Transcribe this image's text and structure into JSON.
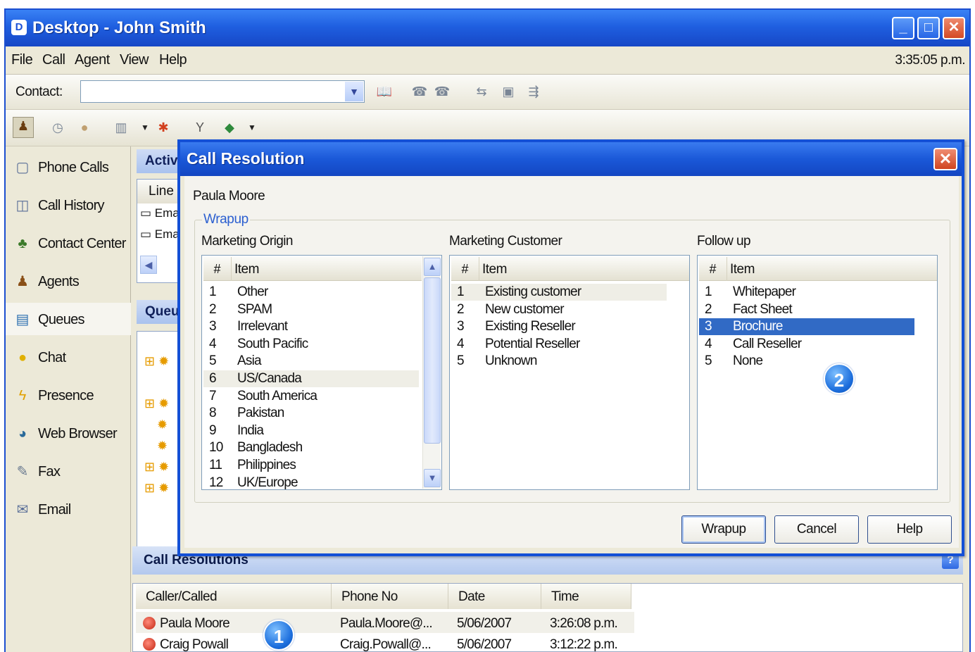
{
  "window": {
    "title": "Desktop - John Smith",
    "clock": "3:35:05 p.m."
  },
  "menu": [
    "File",
    "Call",
    "Agent",
    "View",
    "Help"
  ],
  "toolbar": {
    "contact_label": "Contact:",
    "contact_value": ""
  },
  "nav": [
    {
      "label": "Phone Calls",
      "icon": "phone-icon"
    },
    {
      "label": "Call History",
      "icon": "history-icon"
    },
    {
      "label": "Contact Center",
      "icon": "contact-center-icon"
    },
    {
      "label": "Agents",
      "icon": "agent-icon"
    },
    {
      "label": "Queues",
      "icon": "queue-icon",
      "selected": true
    },
    {
      "label": "Chat",
      "icon": "chat-icon"
    },
    {
      "label": "Presence",
      "icon": "presence-icon"
    },
    {
      "label": "Web Browser",
      "icon": "globe-icon"
    },
    {
      "label": "Fax",
      "icon": "fax-icon"
    },
    {
      "label": "Email",
      "icon": "email-icon"
    }
  ],
  "background_panels": {
    "active_header": "Activ",
    "line_header": "Line",
    "rows": [
      "Ema",
      "Ema"
    ],
    "queue_header": "Queu"
  },
  "dialog": {
    "title": "Call Resolution",
    "caller": "Paula Moore",
    "group_label": "Wrapup",
    "columns": [
      {
        "label": "Marketing Origin",
        "header_num": "#",
        "header_item": "Item",
        "items": [
          "Other",
          "SPAM",
          "Irrelevant",
          "South Pacific",
          "Asia",
          "US/Canada",
          "South America",
          "Pakistan",
          "India",
          "Bangladesh",
          "Philippines",
          "UK/Europe"
        ],
        "highlighted": 6
      },
      {
        "label": "Marketing Customer",
        "header_num": "#",
        "header_item": "Item",
        "items": [
          "Existing customer",
          "New customer",
          "Existing Reseller",
          "Potential Reseller",
          "Unknown"
        ],
        "highlighted": 1
      },
      {
        "label": "Follow up",
        "header_num": "#",
        "header_item": "Item",
        "items": [
          "Whitepaper",
          "Fact Sheet",
          "Brochure",
          "Call Reseller",
          "None"
        ],
        "selected": 3
      }
    ],
    "buttons": {
      "wrapup": "Wrapup",
      "cancel": "Cancel",
      "help": "Help"
    }
  },
  "call_resolutions": {
    "title": "Call Resolutions",
    "headers": [
      "Caller/Called",
      "Phone No",
      "Date",
      "Time"
    ],
    "rows": [
      {
        "caller": "Paula Moore",
        "phone": "Paula.Moore@...",
        "date": "5/06/2007",
        "time": "3:26:08 p.m."
      },
      {
        "caller": "Craig Powall",
        "phone": "Craig.Powall@...",
        "date": "5/06/2007",
        "time": "3:12:22 p.m."
      }
    ]
  },
  "badges": [
    "1",
    "2"
  ],
  "colors": {
    "title_blue": "#1f5fe0",
    "selection": "#316ac5",
    "badge": "#1b6ddc"
  }
}
